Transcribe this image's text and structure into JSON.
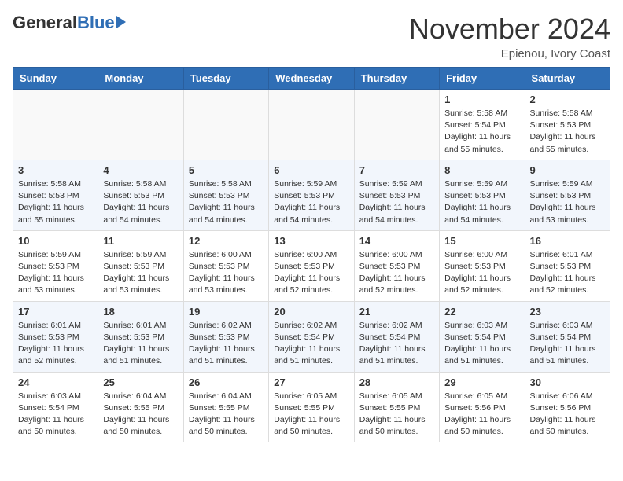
{
  "header": {
    "logo_general": "General",
    "logo_blue": "Blue",
    "month_title": "November 2024",
    "location": "Epienou, Ivory Coast"
  },
  "days_of_week": [
    "Sunday",
    "Monday",
    "Tuesday",
    "Wednesday",
    "Thursday",
    "Friday",
    "Saturday"
  ],
  "weeks": [
    [
      {
        "day": "",
        "info": ""
      },
      {
        "day": "",
        "info": ""
      },
      {
        "day": "",
        "info": ""
      },
      {
        "day": "",
        "info": ""
      },
      {
        "day": "",
        "info": ""
      },
      {
        "day": "1",
        "info": "Sunrise: 5:58 AM\nSunset: 5:54 PM\nDaylight: 11 hours and 55 minutes."
      },
      {
        "day": "2",
        "info": "Sunrise: 5:58 AM\nSunset: 5:53 PM\nDaylight: 11 hours and 55 minutes."
      }
    ],
    [
      {
        "day": "3",
        "info": "Sunrise: 5:58 AM\nSunset: 5:53 PM\nDaylight: 11 hours and 55 minutes."
      },
      {
        "day": "4",
        "info": "Sunrise: 5:58 AM\nSunset: 5:53 PM\nDaylight: 11 hours and 54 minutes."
      },
      {
        "day": "5",
        "info": "Sunrise: 5:58 AM\nSunset: 5:53 PM\nDaylight: 11 hours and 54 minutes."
      },
      {
        "day": "6",
        "info": "Sunrise: 5:59 AM\nSunset: 5:53 PM\nDaylight: 11 hours and 54 minutes."
      },
      {
        "day": "7",
        "info": "Sunrise: 5:59 AM\nSunset: 5:53 PM\nDaylight: 11 hours and 54 minutes."
      },
      {
        "day": "8",
        "info": "Sunrise: 5:59 AM\nSunset: 5:53 PM\nDaylight: 11 hours and 54 minutes."
      },
      {
        "day": "9",
        "info": "Sunrise: 5:59 AM\nSunset: 5:53 PM\nDaylight: 11 hours and 53 minutes."
      }
    ],
    [
      {
        "day": "10",
        "info": "Sunrise: 5:59 AM\nSunset: 5:53 PM\nDaylight: 11 hours and 53 minutes."
      },
      {
        "day": "11",
        "info": "Sunrise: 5:59 AM\nSunset: 5:53 PM\nDaylight: 11 hours and 53 minutes."
      },
      {
        "day": "12",
        "info": "Sunrise: 6:00 AM\nSunset: 5:53 PM\nDaylight: 11 hours and 53 minutes."
      },
      {
        "day": "13",
        "info": "Sunrise: 6:00 AM\nSunset: 5:53 PM\nDaylight: 11 hours and 52 minutes."
      },
      {
        "day": "14",
        "info": "Sunrise: 6:00 AM\nSunset: 5:53 PM\nDaylight: 11 hours and 52 minutes."
      },
      {
        "day": "15",
        "info": "Sunrise: 6:00 AM\nSunset: 5:53 PM\nDaylight: 11 hours and 52 minutes."
      },
      {
        "day": "16",
        "info": "Sunrise: 6:01 AM\nSunset: 5:53 PM\nDaylight: 11 hours and 52 minutes."
      }
    ],
    [
      {
        "day": "17",
        "info": "Sunrise: 6:01 AM\nSunset: 5:53 PM\nDaylight: 11 hours and 52 minutes."
      },
      {
        "day": "18",
        "info": "Sunrise: 6:01 AM\nSunset: 5:53 PM\nDaylight: 11 hours and 51 minutes."
      },
      {
        "day": "19",
        "info": "Sunrise: 6:02 AM\nSunset: 5:53 PM\nDaylight: 11 hours and 51 minutes."
      },
      {
        "day": "20",
        "info": "Sunrise: 6:02 AM\nSunset: 5:54 PM\nDaylight: 11 hours and 51 minutes."
      },
      {
        "day": "21",
        "info": "Sunrise: 6:02 AM\nSunset: 5:54 PM\nDaylight: 11 hours and 51 minutes."
      },
      {
        "day": "22",
        "info": "Sunrise: 6:03 AM\nSunset: 5:54 PM\nDaylight: 11 hours and 51 minutes."
      },
      {
        "day": "23",
        "info": "Sunrise: 6:03 AM\nSunset: 5:54 PM\nDaylight: 11 hours and 51 minutes."
      }
    ],
    [
      {
        "day": "24",
        "info": "Sunrise: 6:03 AM\nSunset: 5:54 PM\nDaylight: 11 hours and 50 minutes."
      },
      {
        "day": "25",
        "info": "Sunrise: 6:04 AM\nSunset: 5:55 PM\nDaylight: 11 hours and 50 minutes."
      },
      {
        "day": "26",
        "info": "Sunrise: 6:04 AM\nSunset: 5:55 PM\nDaylight: 11 hours and 50 minutes."
      },
      {
        "day": "27",
        "info": "Sunrise: 6:05 AM\nSunset: 5:55 PM\nDaylight: 11 hours and 50 minutes."
      },
      {
        "day": "28",
        "info": "Sunrise: 6:05 AM\nSunset: 5:55 PM\nDaylight: 11 hours and 50 minutes."
      },
      {
        "day": "29",
        "info": "Sunrise: 6:05 AM\nSunset: 5:56 PM\nDaylight: 11 hours and 50 minutes."
      },
      {
        "day": "30",
        "info": "Sunrise: 6:06 AM\nSunset: 5:56 PM\nDaylight: 11 hours and 50 minutes."
      }
    ]
  ]
}
